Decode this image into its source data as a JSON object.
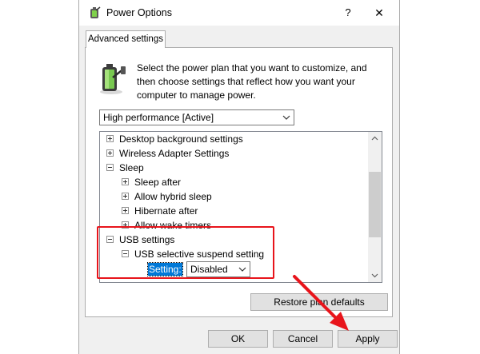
{
  "window": {
    "title": "Power Options",
    "help_glyph": "?",
    "close_glyph": "✕"
  },
  "tab": {
    "label": "Advanced settings"
  },
  "description": "Select the power plan that you want to customize, and then choose settings that reflect how you want your computer to manage power.",
  "plan_select": {
    "value": "High performance [Active]"
  },
  "tree": {
    "items": [
      {
        "label": "Desktop background settings",
        "expander": "plus",
        "level": 0
      },
      {
        "label": "Wireless Adapter Settings",
        "expander": "plus",
        "level": 0
      },
      {
        "label": "Sleep",
        "expander": "minus",
        "level": 0
      },
      {
        "label": "Sleep after",
        "expander": "plus",
        "level": 1
      },
      {
        "label": "Allow hybrid sleep",
        "expander": "plus",
        "level": 1
      },
      {
        "label": "Hibernate after",
        "expander": "plus",
        "level": 1
      },
      {
        "label": "Allow wake timers",
        "expander": "plus",
        "level": 1
      },
      {
        "label": "USB settings",
        "expander": "minus",
        "level": 0
      },
      {
        "label": "USB selective suspend setting",
        "expander": "minus",
        "level": 1
      }
    ],
    "setting": {
      "label": "Setting:",
      "value": "Disabled"
    }
  },
  "buttons": {
    "restore": "Restore plan defaults",
    "ok": "OK",
    "cancel": "Cancel",
    "apply": "Apply"
  },
  "colors": {
    "highlight_box": "#e8141b",
    "annotation_arrow": "#e8141b",
    "selection": "#0078d7"
  }
}
